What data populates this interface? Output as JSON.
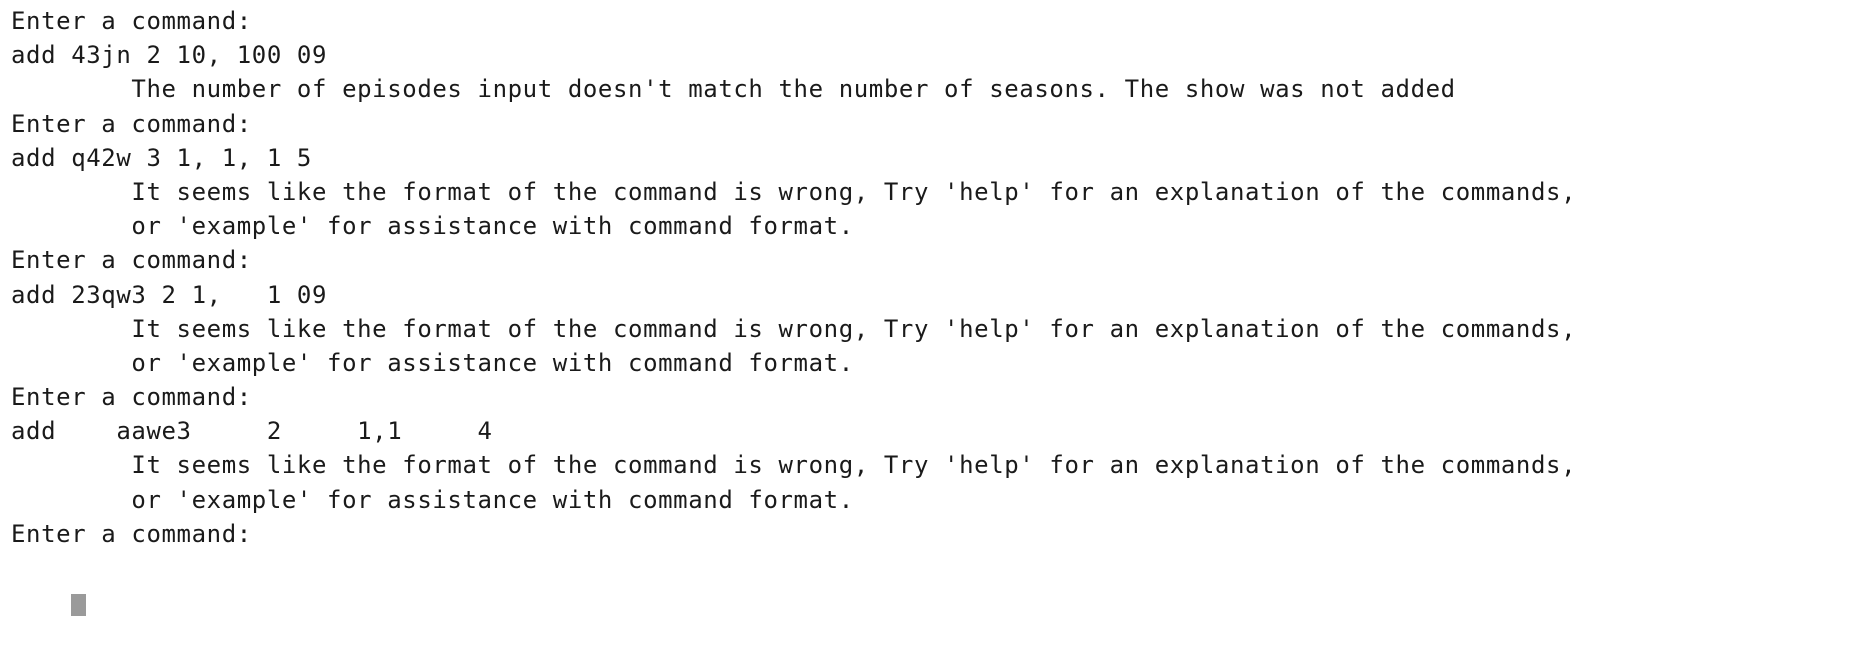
{
  "terminal": {
    "lines": [
      {
        "kind": "prompt",
        "text": "Enter a command:"
      },
      {
        "kind": "input",
        "text": "add 43jn 2 10, 100 09"
      },
      {
        "kind": "output",
        "text": "        The number of episodes input doesn't match the number of seasons. The show was not added"
      },
      {
        "kind": "prompt",
        "text": "Enter a command:"
      },
      {
        "kind": "input",
        "text": "add q42w 3 1, 1, 1 5"
      },
      {
        "kind": "output",
        "text": "        It seems like the format of the command is wrong, Try 'help' for an explanation of the commands,"
      },
      {
        "kind": "output",
        "text": "        or 'example' for assistance with command format."
      },
      {
        "kind": "prompt",
        "text": "Enter a command:"
      },
      {
        "kind": "input",
        "text": "add 23qw3 2 1,   1 09"
      },
      {
        "kind": "output",
        "text": "        It seems like the format of the command is wrong, Try 'help' for an explanation of the commands,"
      },
      {
        "kind": "output",
        "text": "        or 'example' for assistance with command format."
      },
      {
        "kind": "prompt",
        "text": "Enter a command:"
      },
      {
        "kind": "input",
        "text": "add    aawe3     2     1,1     4"
      },
      {
        "kind": "output",
        "text": "        It seems like the format of the command is wrong, Try 'help' for an explanation of the commands,"
      },
      {
        "kind": "output",
        "text": "        or 'example' for assistance with command format."
      },
      {
        "kind": "prompt",
        "text": "Enter a command:"
      }
    ],
    "cursor_color": "#9a9a9a"
  }
}
